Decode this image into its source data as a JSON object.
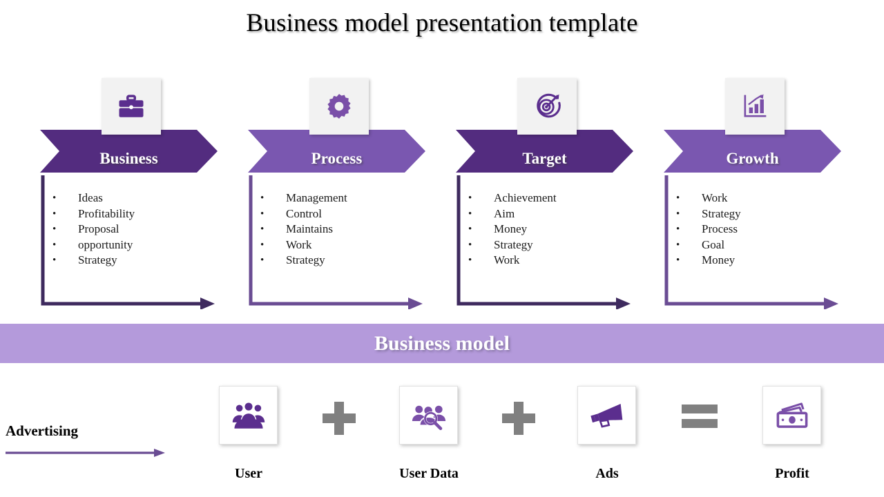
{
  "title": "Business model presentation template",
  "colors": {
    "purple_dark": "#532C7F",
    "purple_light": "#7A57B0",
    "banner": "#B49ADB",
    "gray_operator": "#808080",
    "card_bg": "#F2F2F2"
  },
  "stages": [
    {
      "label": "Business",
      "icon": "briefcase-icon",
      "tone": "dark",
      "bullets": [
        "Ideas",
        "Profitability",
        "Proposal",
        "opportunity",
        "Strategy"
      ]
    },
    {
      "label": "Process",
      "icon": "gear-icon",
      "tone": "light",
      "bullets": [
        "Management",
        "Control",
        "Maintains",
        "Work",
        "Strategy"
      ]
    },
    {
      "label": "Target",
      "icon": "target-icon",
      "tone": "dark",
      "bullets": [
        "Achievement",
        "Aim",
        "Money",
        "Strategy",
        "Work"
      ]
    },
    {
      "label": "Growth",
      "icon": "bar-chart-growth-icon",
      "tone": "light",
      "bullets": [
        "Work",
        "Strategy",
        "Process",
        "Goal",
        "Money"
      ]
    }
  ],
  "banner": {
    "text": "Business model"
  },
  "equation": {
    "advertising_label": "Advertising",
    "items": [
      {
        "label": "User",
        "icon": "users-group-icon"
      },
      {
        "label": "User Data",
        "icon": "user-search-icon"
      },
      {
        "label": "Ads",
        "icon": "megaphone-icon"
      },
      {
        "label": "Profit",
        "icon": "banknotes-icon"
      }
    ],
    "operators": [
      "plus-icon",
      "plus-icon",
      "equals-icon"
    ]
  }
}
